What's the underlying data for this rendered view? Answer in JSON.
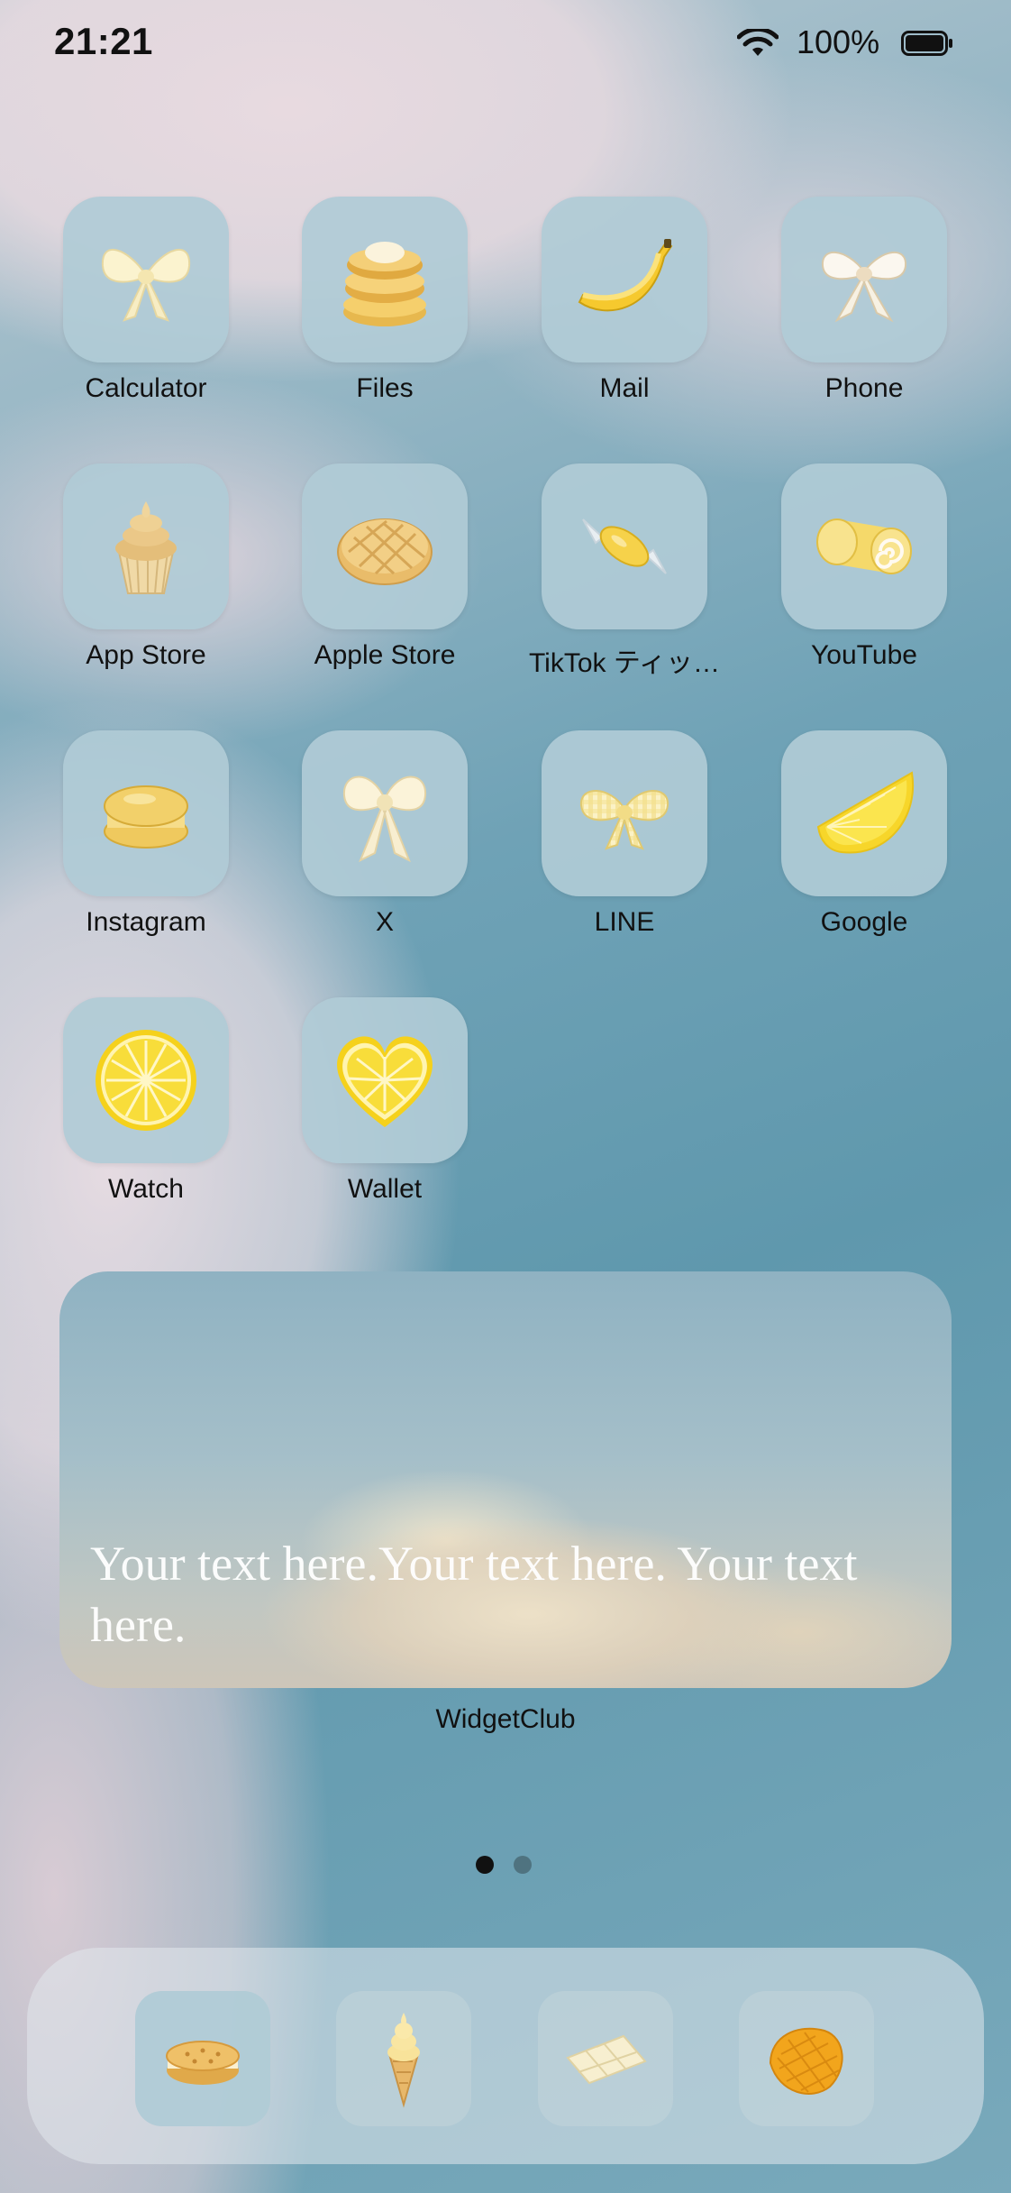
{
  "status_bar": {
    "time": "21:21",
    "battery_percent": "100%",
    "icons": [
      "wifi-icon",
      "battery-icon"
    ]
  },
  "apps": [
    {
      "label": "Calculator",
      "icon": "bow-icon"
    },
    {
      "label": "Files",
      "icon": "pancakes-icon"
    },
    {
      "label": "Mail",
      "icon": "banana-icon"
    },
    {
      "label": "Phone",
      "icon": "bow-icon"
    },
    {
      "label": "App Store",
      "icon": "cupcake-icon"
    },
    {
      "label": "Apple Store",
      "icon": "melonpan-icon"
    },
    {
      "label": "TikTok ティッ…",
      "icon": "candy-icon"
    },
    {
      "label": "YouTube",
      "icon": "roll-cake-icon"
    },
    {
      "label": "Instagram",
      "icon": "macaron-icon"
    },
    {
      "label": "X",
      "icon": "bow-icon"
    },
    {
      "label": "LINE",
      "icon": "gingham-bow-icon"
    },
    {
      "label": "Google",
      "icon": "lemon-wedge-icon"
    },
    {
      "label": "Watch",
      "icon": "lemon-slice-icon"
    },
    {
      "label": "Wallet",
      "icon": "heart-lemon-icon"
    }
  ],
  "widget": {
    "text": "Your text here.Your text here. Your text here.",
    "label": "WidgetClub"
  },
  "page_indicator": {
    "pages": 2,
    "current": 1
  },
  "dock": [
    {
      "icon": "cookie-sandwich-icon"
    },
    {
      "icon": "ice-cream-cone-icon"
    },
    {
      "icon": "white-chocolate-icon"
    },
    {
      "icon": "mango-icon"
    }
  ],
  "colors": {
    "tile": "#b0cbd6",
    "dot_active": "#111111",
    "dot_inactive": "#4f7380"
  }
}
